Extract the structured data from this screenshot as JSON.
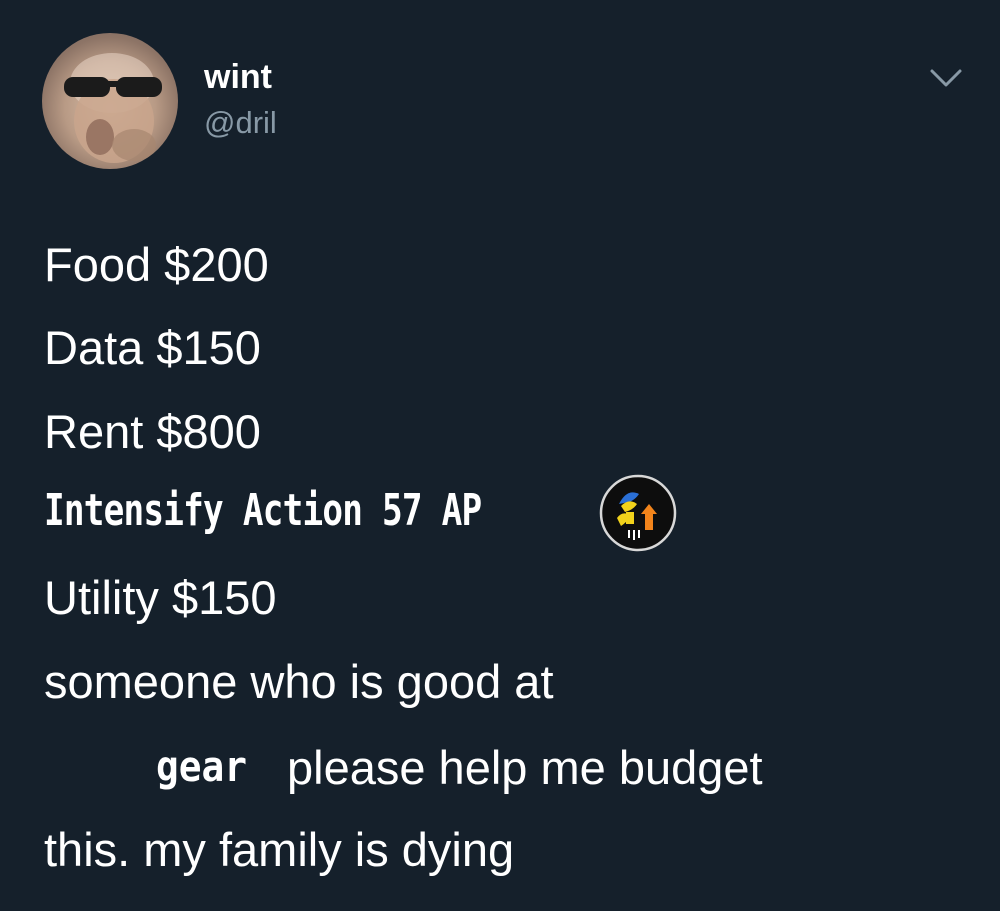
{
  "user": {
    "display_name": "wint",
    "handle": "@dril"
  },
  "icons": {
    "menu": "chevron-down-icon",
    "ability": "intensify-action-ability-icon",
    "avatar": "profile-avatar"
  },
  "tweet": {
    "lines": [
      "Food $200",
      "Data $150",
      "Rent $800",
      "Intensify Action 57 AP",
      "Utility $150",
      "someone who is good at",
      "please help me budget",
      "this. my family is dying"
    ],
    "inline_game_word": "gear"
  },
  "colors": {
    "background": "#15202b",
    "text": "#ffffff",
    "secondary_text": "#8899a6"
  }
}
